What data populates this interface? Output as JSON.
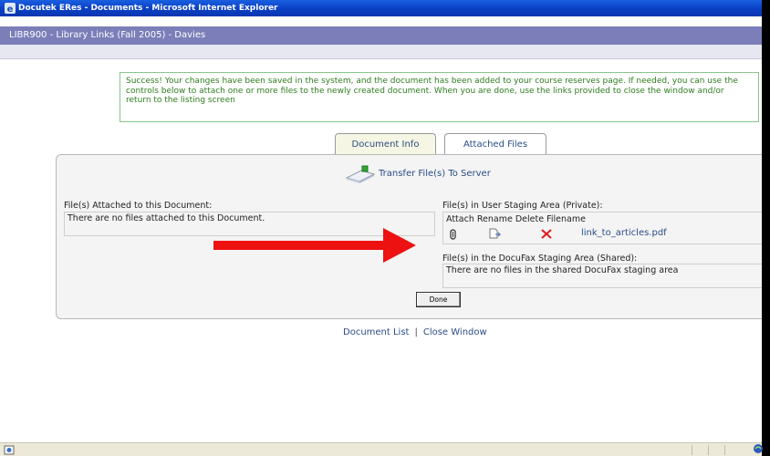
{
  "window": {
    "title": "Docutek ERes - Documents - Microsoft Internet Explorer"
  },
  "course_bar": {
    "title": "LIBR900 - Library Links (Fall 2005) - Davies"
  },
  "success_message": "Success! Your changes have been saved in the system, and the document has been added to your course reserves page. If needed, you can use the controls below to attach one or more files to the newly created document. When you are done, use the links provided to close the window and/or return to the listing screen",
  "tabs": [
    {
      "label": "Document Info",
      "active": false
    },
    {
      "label": "Attached Files",
      "active": true
    }
  ],
  "transfer": {
    "label": "Transfer File(s) To Server",
    "icon": "transfer-icon"
  },
  "attached": {
    "label": "File(s) Attached to this Document:",
    "empty_text": "There are no files attached to this Document."
  },
  "staging": {
    "label": "File(s) in User Staging Area (Private):",
    "columns": "Attach Rename Delete Filename",
    "files": [
      {
        "filename": "link_to_articles.pdf",
        "attach_icon": "paperclip-icon",
        "rename_icon": "rename-icon",
        "delete_icon": "delete-x-icon"
      }
    ]
  },
  "shared": {
    "label": "File(s) in the DocuFax Staging Area (Shared):",
    "empty_text": "There are no files in the shared DocuFax staging area"
  },
  "done_button": "Done",
  "footer_links": {
    "document_list": "Document List",
    "separator": "|",
    "close_window": "Close Window"
  },
  "colors": {
    "title_bar": "#0a3fc4",
    "course_bar": "#7b7eb8",
    "success_text": "#2e7d1e",
    "link": "#2a4c88",
    "arrow": "#ee1111"
  }
}
